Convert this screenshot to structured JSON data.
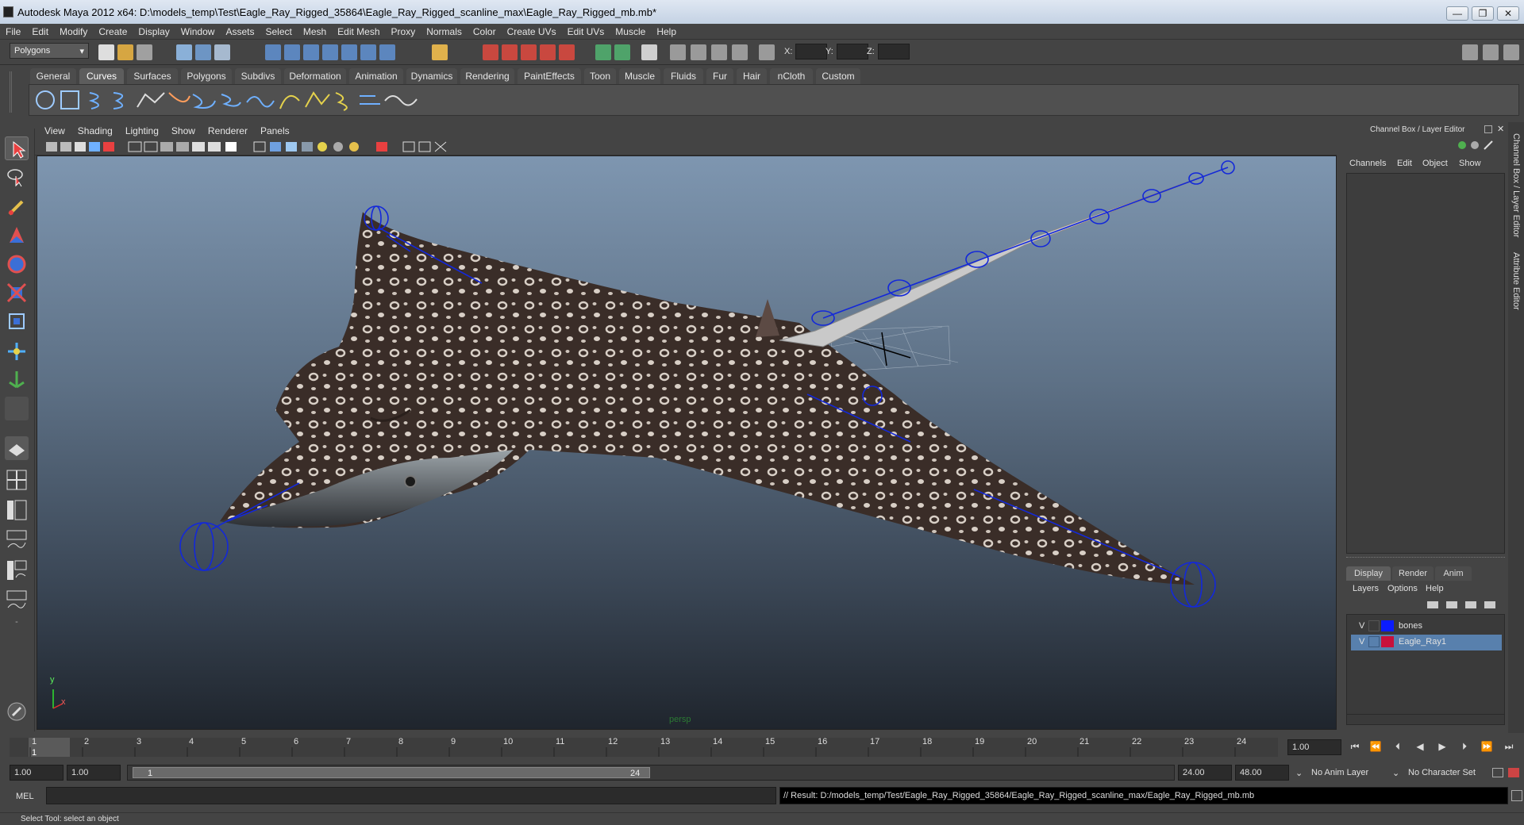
{
  "window": {
    "title": "Autodesk Maya 2012 x64: D:\\models_temp\\Test\\Eagle_Ray_Rigged_35864\\Eagle_Ray_Rigged_scanline_max\\Eagle_Ray_Rigged_mb.mb*",
    "controls": [
      "—",
      "❐",
      "✕"
    ]
  },
  "menu": [
    "File",
    "Edit",
    "Modify",
    "Create",
    "Display",
    "Window",
    "Assets",
    "Select",
    "Mesh",
    "Edit Mesh",
    "Proxy",
    "Normals",
    "Color",
    "Create UVs",
    "Edit UVs",
    "Muscle",
    "Help"
  ],
  "statusline": {
    "menuset": "Polygons",
    "x_label": "X:",
    "y_label": "Y:",
    "z_label": "Z:"
  },
  "shelf": {
    "tabs": [
      "General",
      "Curves",
      "Surfaces",
      "Polygons",
      "Subdivs",
      "Deformation",
      "Animation",
      "Dynamics",
      "Rendering",
      "PaintEffects",
      "Toon",
      "Muscle",
      "Fluids",
      "Fur",
      "Hair",
      "nCloth",
      "Custom"
    ],
    "active_tab": "Curves"
  },
  "panel_menu": [
    "View",
    "Shading",
    "Lighting",
    "Show",
    "Renderer",
    "Panels"
  ],
  "viewport": {
    "camera_label": "persp",
    "axis_y": "y",
    "axis_x": "x"
  },
  "channel_box": {
    "title": "Channel Box / Layer Editor",
    "menu": [
      "Channels",
      "Edit",
      "Object",
      "Show"
    ]
  },
  "layer_editor": {
    "tabs": [
      "Display",
      "Render",
      "Anim"
    ],
    "active_tab": "Display",
    "menu": [
      "Layers",
      "Options",
      "Help"
    ],
    "layers": [
      {
        "visible": "V",
        "name": "bones",
        "color": "#0b1cff",
        "selected": false
      },
      {
        "visible": "V",
        "name": "Eagle_Ray1",
        "color": "#c8103a",
        "selected": true
      }
    ]
  },
  "side_tabs": [
    "Channel Box / Layer Editor",
    "Attribute Editor"
  ],
  "timeline": {
    "ticks": [
      "1",
      "2",
      "3",
      "4",
      "5",
      "6",
      "7",
      "8",
      "9",
      "10",
      "11",
      "12",
      "13",
      "14",
      "15",
      "16",
      "17",
      "18",
      "19",
      "20",
      "21",
      "22",
      "23",
      "24"
    ],
    "current_frame": "1",
    "current_time_field": "1.00"
  },
  "range": {
    "start": "1.00",
    "anim_start": "1.00",
    "slider_start": "1",
    "slider_end": "24",
    "end": "24.00",
    "anim_end": "48.00",
    "anim_layer": "No Anim Layer",
    "char_set": "No Character Set"
  },
  "command": {
    "mode": "MEL",
    "result": "// Result: D:/models_temp/Test/Eagle_Ray_Rigged_35864/Eagle_Ray_Rigged_scanline_max/Eagle_Ray_Rigged_mb.mb"
  },
  "helpline": "Select Tool: select an object"
}
